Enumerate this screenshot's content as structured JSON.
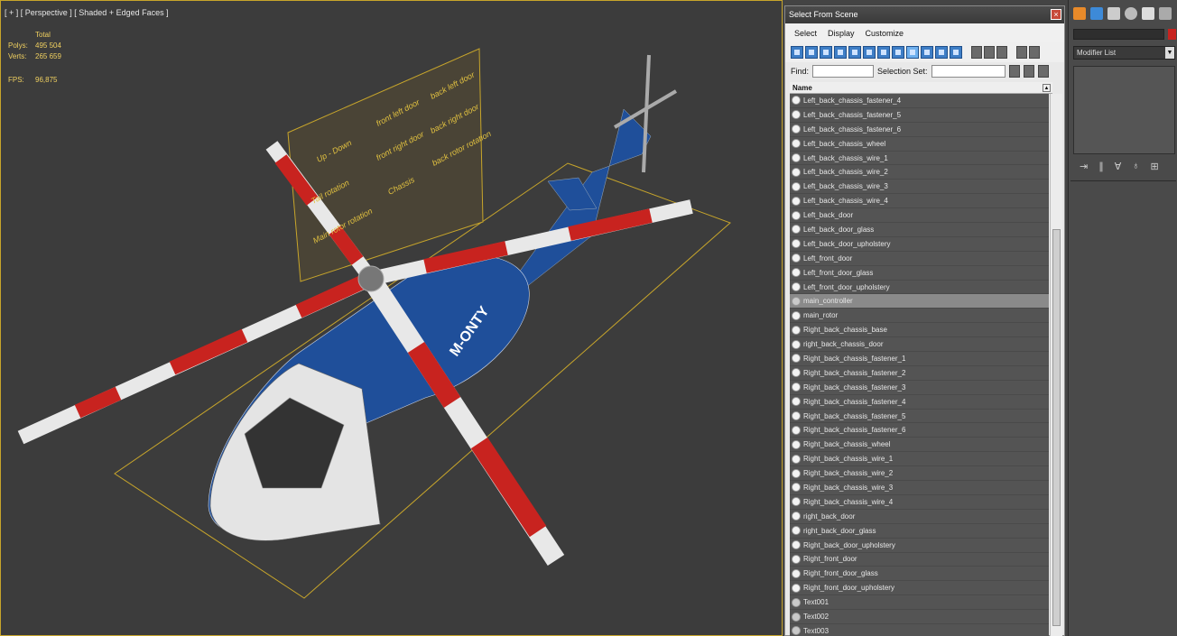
{
  "viewport": {
    "label": "[ + ] [ Perspective ] [ Shaded + Edged Faces ]",
    "stats": {
      "header": "Total",
      "polys_label": "Polys:",
      "polys": "495 504",
      "verts_label": "Verts:",
      "verts": "265 659",
      "fps_label": "FPS:",
      "fps": "96,875"
    },
    "control_panel_labels": [
      "Up - Down",
      "front left door",
      "back left door",
      "Tail rotation",
      "front right door",
      "back right door",
      "Main rotor rotation",
      "Chassis",
      "back rotor rotation"
    ],
    "fuselage_text": "M-ONTY"
  },
  "dialog": {
    "title": "Select From Scene",
    "menu": [
      "Select",
      "Display",
      "Customize"
    ],
    "find_label": "Find:",
    "selection_set_label": "Selection Set:",
    "column_header": "Name",
    "items": [
      "Left_back_chassis_fastener_4",
      "Left_back_chassis_fastener_5",
      "Left_back_chassis_fastener_6",
      "Left_back_chassis_wheel",
      "Left_back_chassis_wire_1",
      "Left_back_chassis_wire_2",
      "Left_back_chassis_wire_3",
      "Left_back_chassis_wire_4",
      "Left_back_door",
      "Left_back_door_glass",
      "Left_back_door_upholstery",
      "Left_front_door",
      "Left_front_door_glass",
      "Left_front_door_upholstery",
      "main_controller",
      "main_rotor",
      "Right_back_chassis_base",
      "right_back_chassis_door",
      "Right_back_chassis_fastener_1",
      "Right_back_chassis_fastener_2",
      "Right_back_chassis_fastener_3",
      "Right_back_chassis_fastener_4",
      "Right_back_chassis_fastener_5",
      "Right_back_chassis_fastener_6",
      "Right_back_chassis_wheel",
      "Right_back_chassis_wire_1",
      "Right_back_chassis_wire_2",
      "Right_back_chassis_wire_3",
      "Right_back_chassis_wire_4",
      "right_back_door",
      "right_back_door_glass",
      "Right_back_door_upholstery",
      "Right_front_door",
      "Right_front_door_glass",
      "Right_front_door_upholstery",
      "Text001",
      "Text002",
      "Text003"
    ],
    "selected_item": "main_controller"
  },
  "command_panel": {
    "modifier_list": "Modifier List"
  },
  "colors": {
    "accent": "#c7a52b",
    "fuselage": "#1f4f9a",
    "rotor_red": "#c8231f",
    "rotor_white": "#e8e8e8"
  }
}
